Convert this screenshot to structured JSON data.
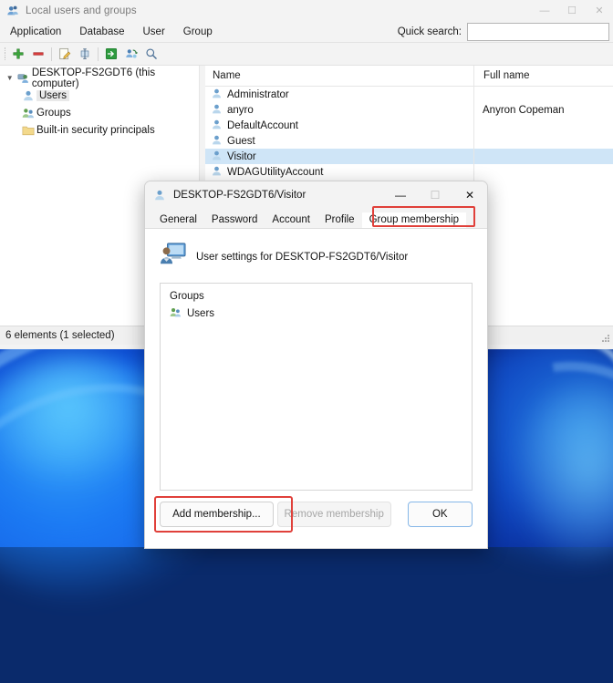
{
  "window": {
    "title": "Local users and groups",
    "icon": "users-app-icon",
    "controls": {
      "minimize": "—",
      "maximize": "☐",
      "close": "✕"
    }
  },
  "menubar": {
    "items": [
      {
        "label": "Application",
        "name": "menu-application"
      },
      {
        "label": "Database",
        "name": "menu-database"
      },
      {
        "label": "User",
        "name": "menu-user"
      },
      {
        "label": "Group",
        "name": "menu-group"
      }
    ],
    "quick_search": {
      "label": "Quick search:",
      "value": "",
      "placeholder": ""
    }
  },
  "toolbar": {
    "buttons": [
      {
        "name": "add-icon",
        "title": "Add"
      },
      {
        "name": "remove-icon",
        "title": "Remove"
      },
      {
        "name": "edit-icon",
        "title": "Edit"
      },
      {
        "name": "rename-icon",
        "title": "Rename"
      },
      {
        "name": "export-icon",
        "title": "Export"
      },
      {
        "name": "refresh-icon",
        "title": "Refresh"
      },
      {
        "name": "search-icon",
        "title": "Search"
      }
    ]
  },
  "tree": {
    "root": {
      "label": "DESKTOP-FS2GDT6 (this computer)",
      "icon": "computer-users-icon",
      "expanded": true
    },
    "children": [
      {
        "label": "Users",
        "icon": "user-icon",
        "selected": true
      },
      {
        "label": "Groups",
        "icon": "group-icon",
        "selected": false
      },
      {
        "label": "Built-in security principals",
        "icon": "folder-icon",
        "selected": false
      }
    ]
  },
  "list": {
    "columns": [
      "Name",
      "Full name"
    ],
    "rows": [
      {
        "name": "Administrator",
        "full_name": "",
        "selected": false
      },
      {
        "name": "anyro",
        "full_name": "Anyron Copeman",
        "selected": false
      },
      {
        "name": "DefaultAccount",
        "full_name": "",
        "selected": false
      },
      {
        "name": "Guest",
        "full_name": "",
        "selected": false
      },
      {
        "name": "Visitor",
        "full_name": "",
        "selected": true
      },
      {
        "name": "WDAGUtilityAccount",
        "full_name": "",
        "selected": false
      }
    ]
  },
  "statusbar": {
    "text": "6 elements  (1 selected)"
  },
  "dialog": {
    "title": "DESKTOP-FS2GDT6/Visitor",
    "icon": "user-icon",
    "controls": {
      "minimize": "—",
      "maximize": "☐",
      "close": "✕"
    },
    "tabs": [
      {
        "label": "General",
        "active": false
      },
      {
        "label": "Password",
        "active": false
      },
      {
        "label": "Account",
        "active": false
      },
      {
        "label": "Profile",
        "active": false
      },
      {
        "label": "Group membership",
        "active": true,
        "highlighted": true
      }
    ],
    "header": {
      "text": "User settings for DESKTOP-FS2GDT6/Visitor",
      "icon": "user-settings-icon"
    },
    "groups_box": {
      "label": "Groups",
      "items": [
        {
          "label": "Users",
          "icon": "group-icon"
        }
      ]
    },
    "buttons": [
      {
        "label": "Add membership...",
        "name": "add-membership-button",
        "enabled": true,
        "highlighted": true
      },
      {
        "label": "Remove membership",
        "name": "remove-membership-button",
        "enabled": false,
        "highlighted": false
      },
      {
        "label": "OK",
        "name": "ok-button",
        "enabled": true,
        "default": true
      }
    ]
  },
  "colors": {
    "accent_highlight": "#e0403a",
    "selection": "#cfe5f7",
    "window_bg": "#f3f3f3",
    "default_button_border": "#86b7e8"
  }
}
